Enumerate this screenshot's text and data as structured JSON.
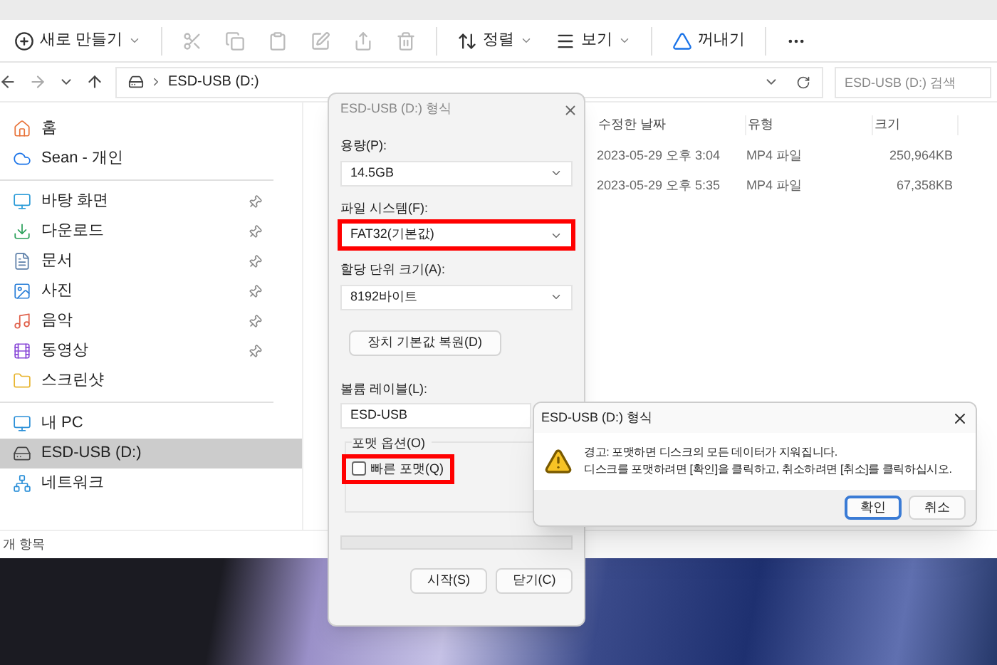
{
  "toolbar": {
    "items": [
      {
        "kind": "new",
        "label": "새로 만들기"
      },
      {
        "kind": "cut"
      },
      {
        "kind": "copy"
      },
      {
        "kind": "paste"
      },
      {
        "kind": "rename"
      },
      {
        "kind": "share"
      },
      {
        "kind": "delete"
      },
      {
        "kind": "sort",
        "label": "정렬"
      },
      {
        "kind": "view",
        "label": "보기"
      },
      {
        "kind": "eject",
        "label": "꺼내기"
      },
      {
        "kind": "more"
      }
    ]
  },
  "address": {
    "path": "ESD-USB (D:)"
  },
  "search": {
    "placeholder": "ESD-USB (D:) 검색"
  },
  "sidebar": {
    "groups": [
      [
        {
          "label": "홈",
          "pinned": false,
          "selected": false
        },
        {
          "label": "Sean - 개인",
          "pinned": false,
          "selected": false
        }
      ],
      [
        {
          "label": "바탕 화면",
          "pinned": true,
          "selected": false
        },
        {
          "label": "다운로드",
          "pinned": true,
          "selected": false
        },
        {
          "label": "문서",
          "pinned": true,
          "selected": false
        },
        {
          "label": "사진",
          "pinned": true,
          "selected": false
        },
        {
          "label": "음악",
          "pinned": true,
          "selected": false
        },
        {
          "label": "동영상",
          "pinned": true,
          "selected": false
        },
        {
          "label": "스크린샷",
          "pinned": false,
          "selected": false
        }
      ],
      [
        {
          "label": "내 PC",
          "pinned": false,
          "selected": false
        },
        {
          "label": "ESD-USB (D:)",
          "pinned": false,
          "selected": true
        },
        {
          "label": "네트워크",
          "pinned": false,
          "selected": false
        }
      ]
    ]
  },
  "table": {
    "columns": [
      "수정한 날짜",
      "유형",
      "크기"
    ],
    "rows": [
      [
        "2023-05-29 오후 3:04",
        "MP4 파일",
        "250,964KB"
      ],
      [
        "2023-05-29 오후 5:35",
        "MP4 파일",
        "67,358KB"
      ]
    ]
  },
  "status_bar": {
    "text": "개 항목"
  },
  "format_dialog": {
    "title": "ESD-USB (D:) 형식",
    "fields": [
      {
        "kind": "select",
        "label": "용량(P):",
        "value": "14.5GB",
        "highlighted": false
      },
      {
        "kind": "select",
        "label": "파일 시스템(F):",
        "value": "FAT32(기본값)",
        "highlighted": true
      },
      {
        "kind": "select",
        "label": "할당 단위 크기(A):",
        "value": "8192바이트",
        "highlighted": false
      }
    ],
    "restore_button": "장치 기본값 복원(D)",
    "volume_label": {
      "label": "볼륨 레이블(L):",
      "value": "ESD-USB"
    },
    "options": {
      "title": "포맷 옵션(O)",
      "quick_format": {
        "label": "빠른 포맷(Q)",
        "checked": false,
        "highlighted": true
      }
    },
    "progress": {
      "level": 0
    },
    "buttons": [
      "시작(S)",
      "닫기(C)"
    ]
  },
  "warning_dialog": {
    "title": "ESD-USB (D:) 형식",
    "lines": [
      "경고: 포맷하면 디스크의 모든 데이터가 지워집니다.",
      "디스크를 포맷하려면 [확인]을 클릭하고, 취소하려면 [취소]를 클릭하십시오."
    ],
    "buttons": [
      {
        "label": "확인",
        "selected": true
      },
      {
        "label": "취소",
        "selected": false
      }
    ]
  }
}
